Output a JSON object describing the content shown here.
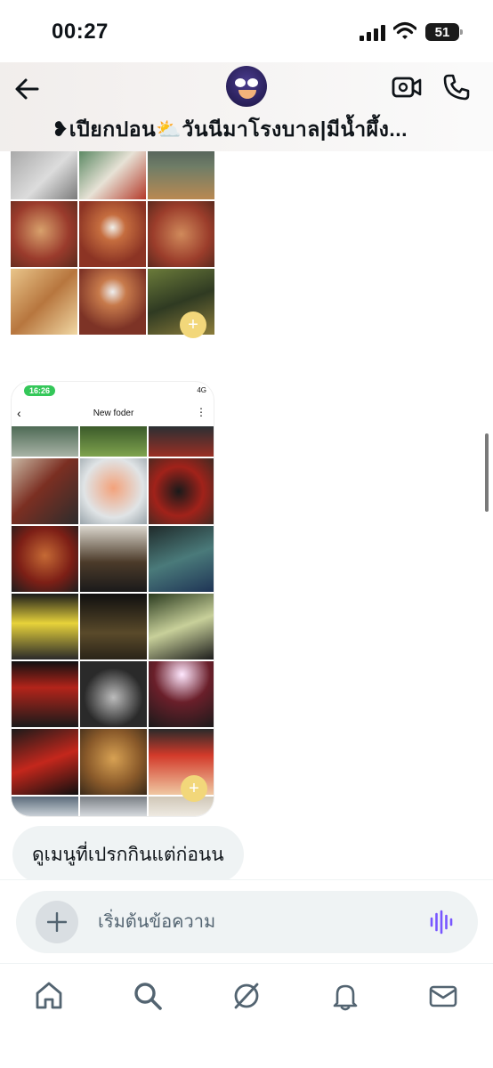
{
  "status_bar": {
    "time": "00:27",
    "battery": "51"
  },
  "header": {
    "title": "❥เปียกปอน⛅วันนีมาโรงบาล|มีน้ำผึ้ง..."
  },
  "media": {
    "folder_time": "16:26",
    "folder_network": "4G",
    "folder_title": "New foder",
    "add_symbol": "+"
  },
  "messages": [
    {
      "text": "ดูเมนูที่เปรกกินแต่ก่อนน"
    }
  ],
  "composer": {
    "placeholder": "เริ่มต้นข้อความ",
    "value": ""
  },
  "icons": {
    "back": "back-arrow-icon",
    "video": "video-call-icon",
    "call": "phone-icon",
    "add": "plus-icon",
    "voice": "voice-wave-icon",
    "scroll": "arrow-down-icon",
    "nav": [
      "home-icon",
      "search-icon",
      "grok-icon",
      "bell-icon",
      "mail-icon"
    ]
  },
  "colors": {
    "accent": "#1d9bf0",
    "voice": "#7856ff",
    "bubble": "#eff3f4",
    "badge": "#f2d77a",
    "phone_time_pill": "#34c759"
  }
}
